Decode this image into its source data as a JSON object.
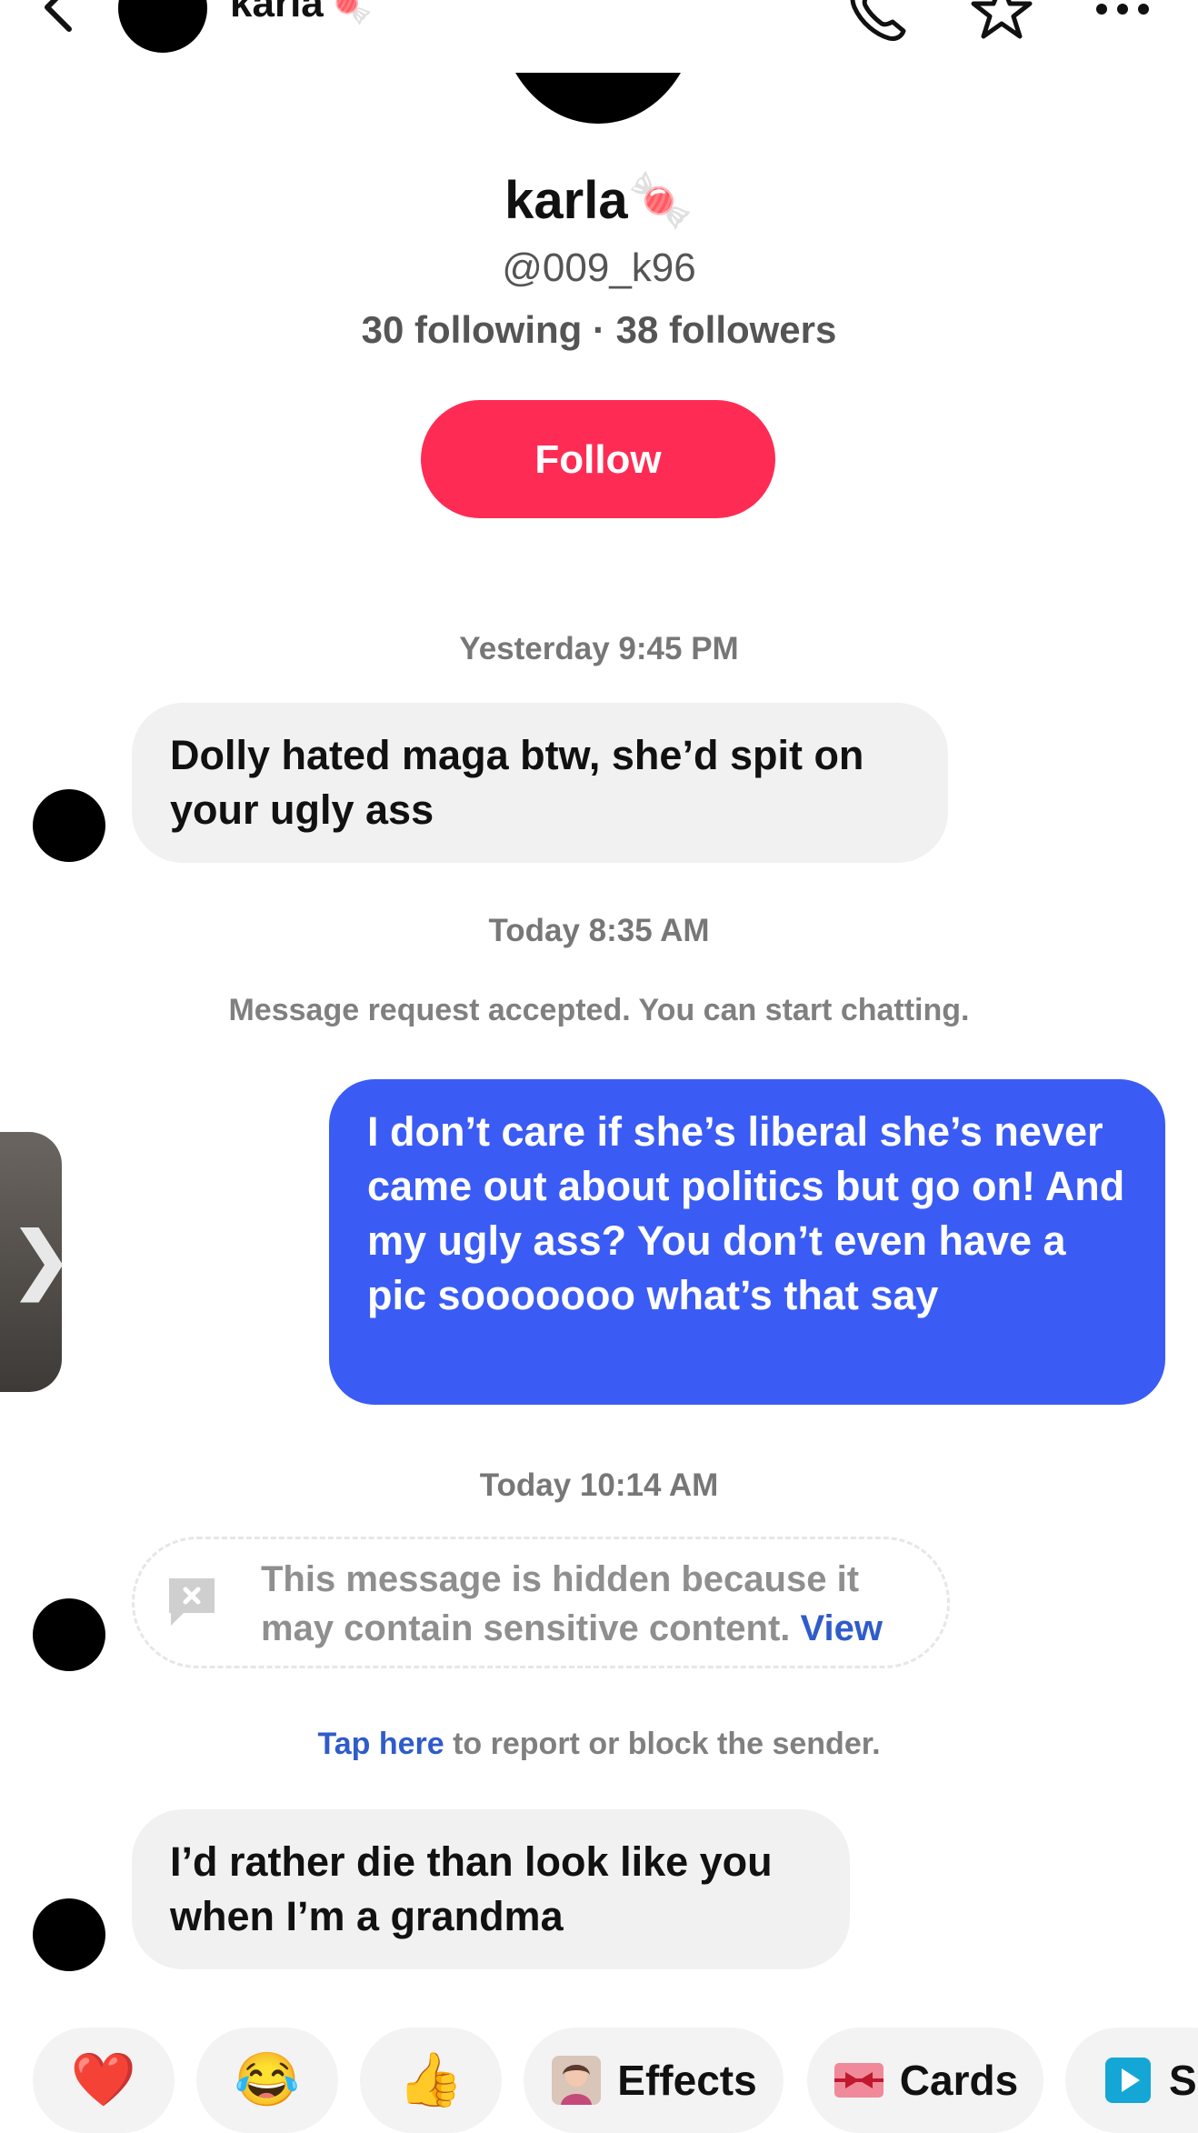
{
  "header": {
    "name": "karla🍬",
    "icons": [
      "back-icon",
      "phone-icon",
      "star-icon",
      "more-icon"
    ]
  },
  "profile": {
    "name": "karla🍬",
    "handle": "@009_k96",
    "stats": "30 following · 38 followers",
    "follow_label": "Follow"
  },
  "messages": {
    "ts1": "Yesterday 9:45 PM",
    "msg1": "Dolly hated maga btw, she’d spit on your ugly ass",
    "ts2": "Today 8:35 AM",
    "notice": "Message request accepted. You can start chatting.",
    "msg2": "I don’t care if she’s liberal she’s never came out about politics but go on! And my ugly ass? You don’t even have a pic sooooooo what’s that say",
    "ts3": "Today 10:14 AM",
    "hidden_text": "This message is hidden because it may contain sensitive content.",
    "hidden_view": "View",
    "report_link": "Tap here",
    "report_text": " to report or block the sender.",
    "msg3": "I’d rather die than look like you when I’m a grandma"
  },
  "side_tab": {
    "chevron": "❯"
  },
  "quick_actions": {
    "heart": "❤️",
    "laugh": "😂",
    "thumbs": "👍",
    "effects": "Effects",
    "cards": "Cards",
    "share": "Sh"
  },
  "colors": {
    "follow": "#fe2c55",
    "outgoing_bubble": "#3a5cf5",
    "incoming_bubble": "#f1f1f2",
    "link": "#2f5cc9"
  }
}
